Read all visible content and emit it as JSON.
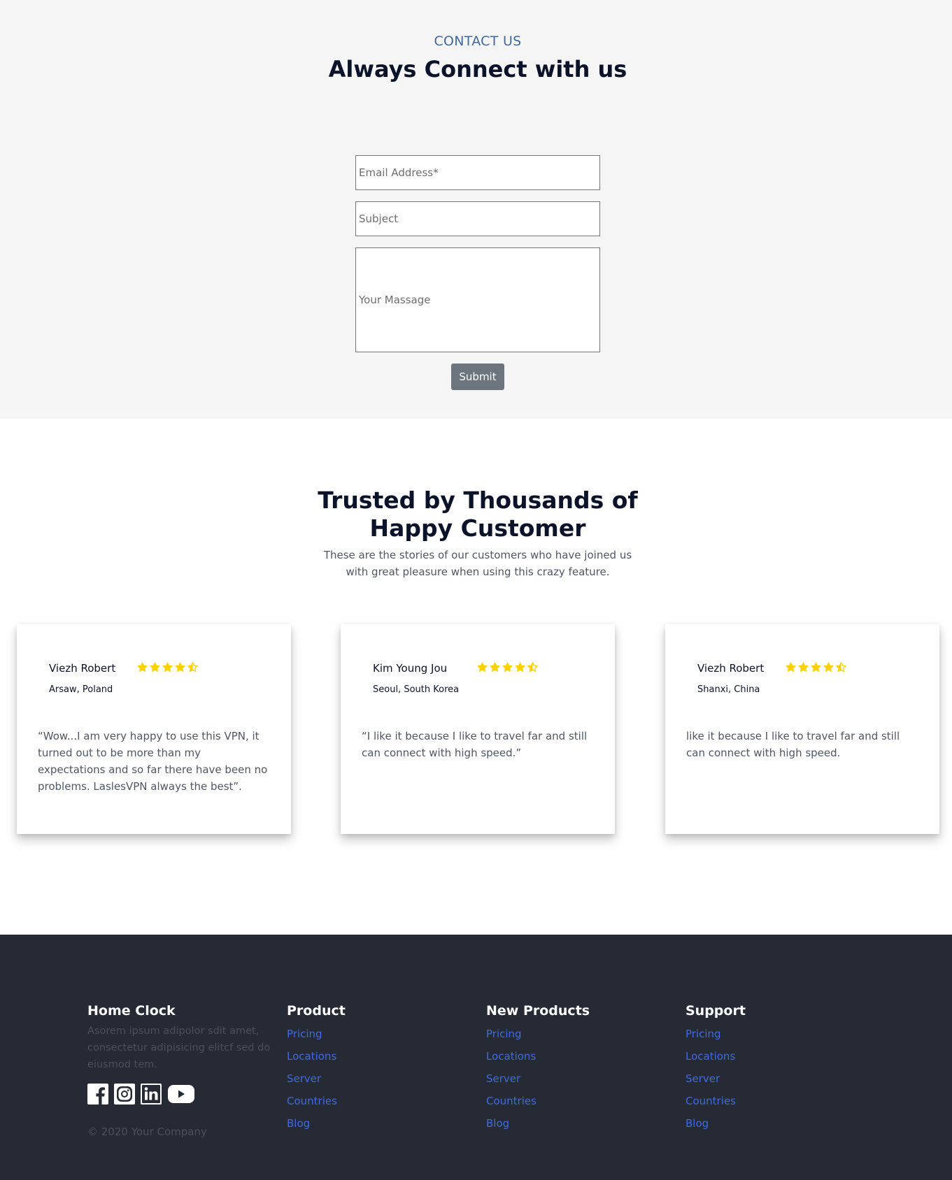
{
  "contact": {
    "eyebrow": "CONTACT US",
    "title": "Always Connect with us",
    "email_placeholder": "Email Address*",
    "subject_placeholder": "Subject",
    "message_placeholder": "Your Massage",
    "submit_label": "Submit"
  },
  "testimonials": {
    "title_line1": "Trusted by Thousands of",
    "title_line2": "Happy Customer",
    "subtitle_line1": "These are the stories of our customers who have joined us",
    "subtitle_line2": "with great pleasure when using this crazy feature.",
    "star_color": "#fed000",
    "cards": [
      {
        "name": "Viezh Robert",
        "location": "Arsaw, Poland",
        "rating": 4.5,
        "quote": "“Wow...I am very happy to use this VPN, it turned out to be more than my expectations and so far there have been no problems. LaslesVPN always the best”."
      },
      {
        "name": "Kim Young Jou",
        "location": "Seoul, South Korea",
        "rating": 4.5,
        "quote": "“I like it because I like to travel far and still can connect with high speed.”"
      },
      {
        "name": "Viezh Robert",
        "location": "Shanxi, China",
        "rating": 4.5,
        "quote": "like it because I like to travel far and still can connect with high speed."
      }
    ]
  },
  "footer": {
    "brand": "Home Clock",
    "description": "Asorem ipsum adipolor sdit amet, consectetur adipisicing elitcf sed do eiusmod tem.",
    "social_icons": [
      "facebook-icon",
      "instagram-icon",
      "linkedin-icon",
      "youtube-icon"
    ],
    "columns": [
      {
        "heading": "Product",
        "links": [
          "Pricing",
          "Locations",
          "Server",
          "Countries",
          "Blog"
        ]
      },
      {
        "heading": "New Products",
        "links": [
          "Pricing",
          "Locations",
          "Server",
          "Countries",
          "Blog"
        ]
      },
      {
        "heading": "Support",
        "links": [
          "Pricing",
          "Locations",
          "Server",
          "Countries",
          "Blog"
        ]
      }
    ],
    "copyright": "© 2020 Your Company",
    "link_color": "#3f6bdf",
    "background": "#262a35"
  }
}
